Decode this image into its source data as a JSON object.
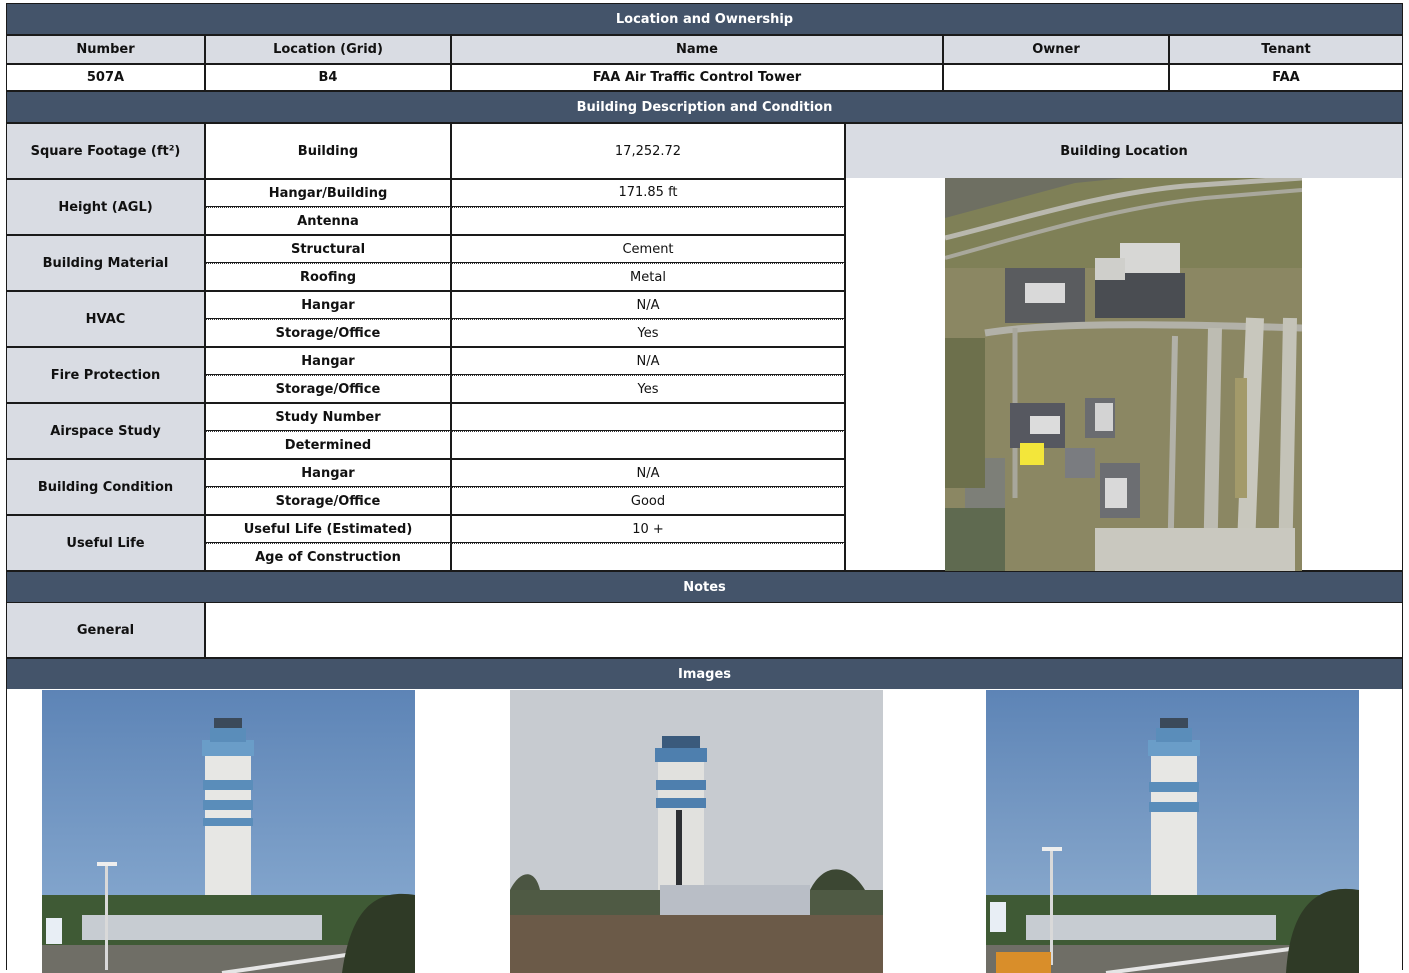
{
  "sections": {
    "location": "Location and Ownership",
    "description": "Building Description and Condition",
    "notes": "Notes",
    "images": "Images"
  },
  "ownership": {
    "headers": [
      "Number",
      "Location (Grid)",
      "Name",
      "Owner",
      "Tenant"
    ],
    "values": [
      "507A",
      "B4",
      "FAA Air Traffic Control Tower",
      "",
      "FAA"
    ]
  },
  "square_footage": {
    "label": "Square Footage (ft²)",
    "sub": "Building",
    "value": "17,252.72"
  },
  "building_location_label": "Building Location",
  "groups": [
    {
      "label": "Height (AGL)",
      "rows": [
        {
          "sub": "Hangar/Building",
          "value": "171.85 ft"
        },
        {
          "sub": "Antenna",
          "value": ""
        }
      ]
    },
    {
      "label": "Building Material",
      "rows": [
        {
          "sub": "Structural",
          "value": "Cement"
        },
        {
          "sub": "Roofing",
          "value": "Metal"
        }
      ]
    },
    {
      "label": "HVAC",
      "rows": [
        {
          "sub": "Hangar",
          "value": "N/A"
        },
        {
          "sub": "Storage/Office",
          "value": "Yes"
        }
      ]
    },
    {
      "label": "Fire Protection",
      "rows": [
        {
          "sub": "Hangar",
          "value": "N/A"
        },
        {
          "sub": "Storage/Office",
          "value": "Yes"
        }
      ]
    },
    {
      "label": "Airspace Study",
      "rows": [
        {
          "sub": "Study Number",
          "value": ""
        },
        {
          "sub": "Determined",
          "value": ""
        }
      ]
    },
    {
      "label": "Building Condition",
      "rows": [
        {
          "sub": "Hangar",
          "value": "N/A"
        },
        {
          "sub": "Storage/Office",
          "value": "Good"
        }
      ]
    },
    {
      "label": "Useful Life",
      "rows": [
        {
          "sub": "Useful Life (Estimated)",
          "value": "10 +"
        },
        {
          "sub": "Age of Construction",
          "value": ""
        }
      ]
    }
  ],
  "notes": {
    "label": "General",
    "value": ""
  },
  "colors": {
    "band": "#44546a",
    "header_fill": "#d9dce3",
    "highlight": "#f3e63a"
  }
}
